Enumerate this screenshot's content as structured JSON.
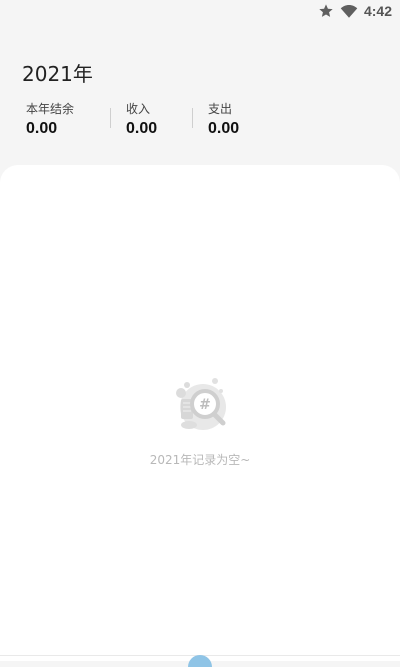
{
  "status_bar": {
    "time": "4:42",
    "icons": [
      "star-icon",
      "wifi-icon"
    ]
  },
  "header": {
    "year_title": "2021年"
  },
  "stats": [
    {
      "label": "本年结余",
      "value": "0.00"
    },
    {
      "label": "收入",
      "value": "0.00"
    },
    {
      "label": "支出",
      "value": "0.00"
    }
  ],
  "empty_state": {
    "text": "2021年记录为空~",
    "icon": "empty-records-icon"
  },
  "colors": {
    "background": "#f5f5f5",
    "panel": "#ffffff",
    "empty_text": "#b8b8b8"
  }
}
